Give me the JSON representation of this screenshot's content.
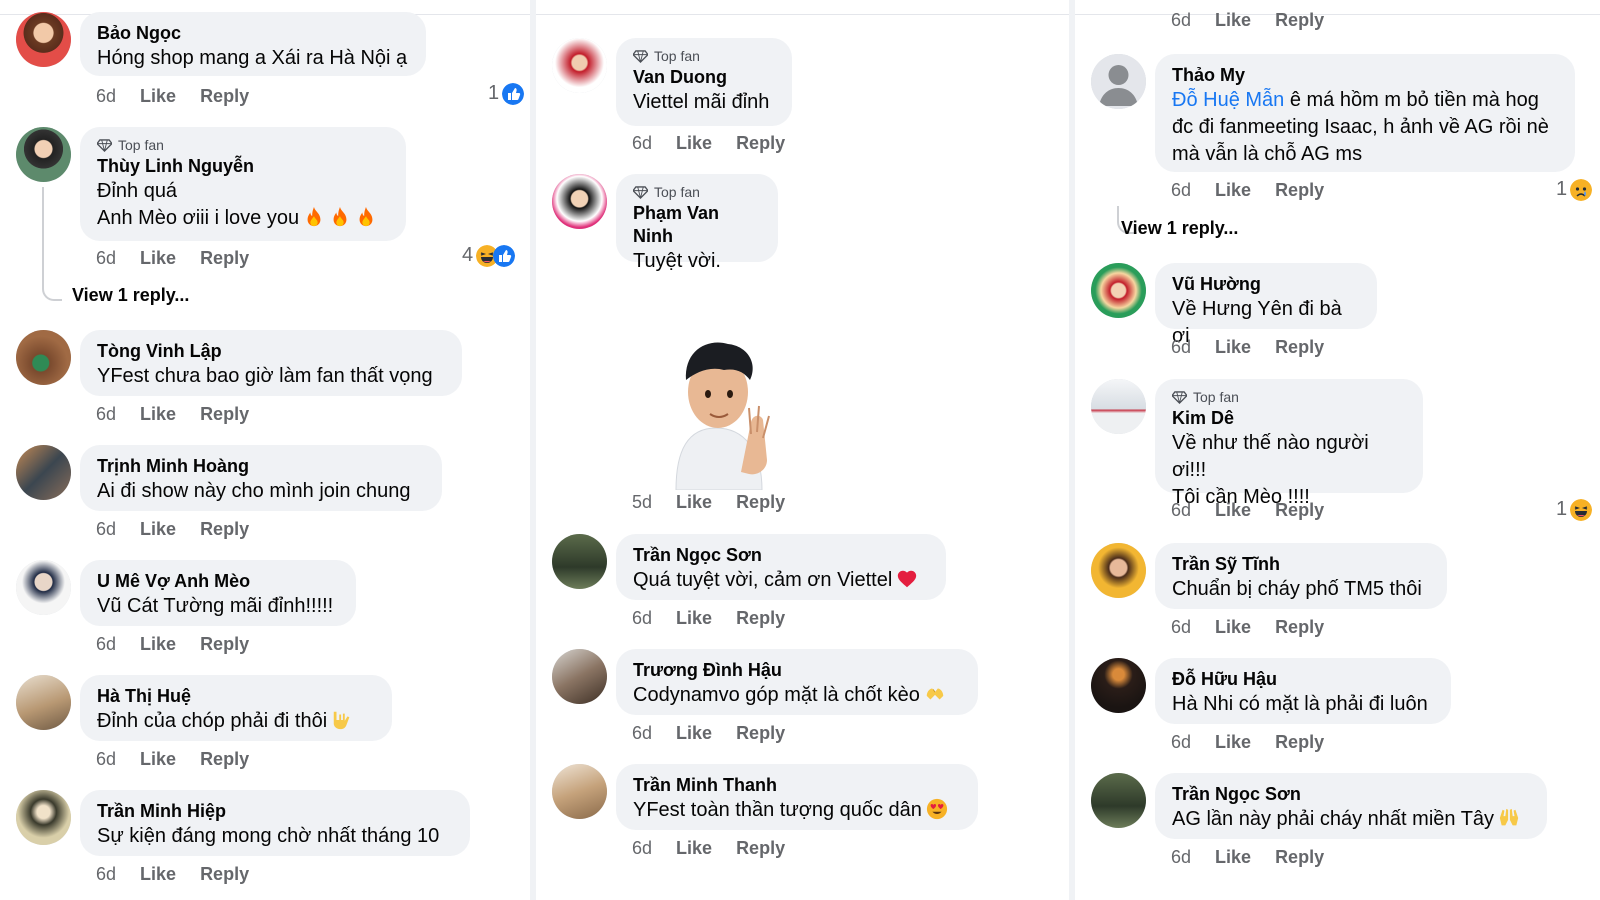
{
  "colors": {
    "bubble": "#f0f2f5",
    "meta": "#65676b",
    "like_blue": "#1877f2",
    "heart": "#e41e3f"
  },
  "common": {
    "like": "Like",
    "reply": "Reply",
    "top_fan": "Top fan",
    "view_reply": "View 1 reply..."
  },
  "col1": [
    {
      "name": "Bảo Ngọc",
      "text": "Hóng shop mang a Xái ra Hà Nội ạ",
      "time": "6d",
      "reactions": {
        "count": "1",
        "icons": [
          "like"
        ]
      }
    },
    {
      "name": "Thùy Linh Nguyễn",
      "top_fan": true,
      "text": "Đỉnh quá\nAnh Mèo ơiii i love you",
      "emoji": "fire-x3",
      "time": "6d",
      "reactions": {
        "count": "4",
        "icons": [
          "haha",
          "like"
        ]
      },
      "view_reply": true
    },
    {
      "name": "Tòng Vinh Lập",
      "text": "YFest chưa bao giờ làm fan thất vọng",
      "time": "6d"
    },
    {
      "name": "Trịnh Minh Hoàng",
      "text": "Ai đi show này cho mình join chung",
      "time": "6d"
    },
    {
      "name": "U Mê Vợ Anh Mèo",
      "text": "Vũ Cát Tường mãi đỉnh!!!!!",
      "time": "6d"
    },
    {
      "name": "Hà Thị Huệ",
      "text": "Đỉnh của chóp phải đi thôi",
      "emoji": "rock-hand",
      "time": "6d"
    },
    {
      "name": "Trần Minh Hiệp",
      "text": "Sự kiện đáng mong chờ nhất tháng 10",
      "time": "6d"
    }
  ],
  "col2": [
    {
      "name": "Van Duong",
      "top_fan": true,
      "text": "Viettel mãi đỉnh",
      "time": "6d"
    },
    {
      "name": "Phạm Van Ninh",
      "top_fan": true,
      "text": "Tuyệt vời.",
      "time": "5d",
      "sticker": "waving-boy-sticker"
    },
    {
      "name": "Trần Ngọc Sơn",
      "text": "Quá tuyệt vời, cảm ơn Viettel",
      "emoji": "red-heart",
      "time": "6d"
    },
    {
      "name": "Trương Đình Hậu",
      "text": "Codynamvo góp mặt là chốt kèo",
      "emoji": "heart-hands",
      "time": "6d"
    },
    {
      "name": "Trần Minh Thanh",
      "text": "YFest toàn thần tượng quốc dân",
      "emoji": "heart-eyes",
      "time": "6d"
    }
  ],
  "col3": [
    {
      "time": "6d",
      "header_only": true
    },
    {
      "name": "Thảo My",
      "mention": "Đỗ Huệ Mẫn",
      "text": " ê má hồm m bỏ tiền mà hog\nđc đi fanmeeting Isaac, h ảnh về AG rồi nè\nmà vẫn là chỗ AG ms",
      "time": "6d",
      "reactions": {
        "count": "1",
        "icons": [
          "sad"
        ]
      },
      "view_reply": true
    },
    {
      "name": "Vũ Hường",
      "text": "Về Hưng Yên đi bà ơi",
      "time": "6d"
    },
    {
      "name": "Kim Dê",
      "top_fan": true,
      "text": "Về như thế nào người ơi!!!\nTôi cần Mèo !!!!",
      "time": "6d",
      "reactions": {
        "count": "1",
        "icons": [
          "haha"
        ]
      }
    },
    {
      "name": "Trần Sỹ Tĩnh",
      "text": "Chuẩn bị cháy phố TM5 thôi",
      "time": "6d"
    },
    {
      "name": "Đỗ Hữu Hậu",
      "text": "Hà Nhi có mặt là phải đi luôn",
      "time": "6d"
    },
    {
      "name": "Trần Ngọc Sơn",
      "text": "AG lần này phải cháy nhất miền Tây",
      "emoji": "raised-hands",
      "time": "6d"
    }
  ]
}
